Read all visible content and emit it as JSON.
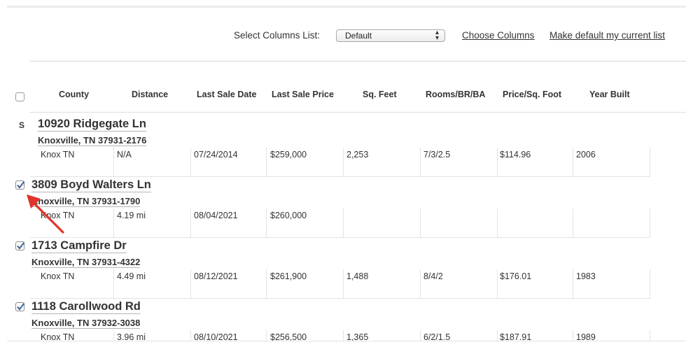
{
  "toolbar": {
    "columns_label": "Select Columns List:",
    "columns_value": "Default",
    "choose_columns": "Choose Columns",
    "make_default": "Make default my current list"
  },
  "headers": [
    "County",
    "Distance",
    "Last Sale Date",
    "Last Sale Price",
    "Sq. Feet",
    "Rooms/BR/BA",
    "Price/Sq. Foot",
    "Year Built"
  ],
  "listings": [
    {
      "tag": "S",
      "checked": false,
      "address": "10920 Ridgegate Ln",
      "city": "Knoxville, TN 37931-2176",
      "county": "Knox TN",
      "distance": "N/A",
      "sale_date": "07/24/2014",
      "sale_price": "$259,000",
      "sqft": "2,253",
      "rooms": "7/3/2.5",
      "price_sqft": "$114.96",
      "year": "2006"
    },
    {
      "tag": "",
      "checked": true,
      "address": "3809 Boyd Walters Ln",
      "city": "Knoxville, TN 37931-1790",
      "county": "Knox TN",
      "distance": "4.19 mi",
      "sale_date": "08/04/2021",
      "sale_price": "$260,000",
      "sqft": "",
      "rooms": "",
      "price_sqft": "",
      "year": ""
    },
    {
      "tag": "",
      "checked": true,
      "address": "1713 Campfire Dr",
      "city": "Knoxville, TN 37931-4322",
      "county": "Knox TN",
      "distance": "4.49 mi",
      "sale_date": "08/12/2021",
      "sale_price": "$261,900",
      "sqft": "1,488",
      "rooms": "8/4/2",
      "price_sqft": "$176.01",
      "year": "1983"
    },
    {
      "tag": "",
      "checked": true,
      "address": "1118 Carollwood Rd",
      "city": "Knoxville, TN 37932-3038",
      "county": "Knox TN",
      "distance": "3.96 mi",
      "sale_date": "08/10/2021",
      "sale_price": "$256,500",
      "sqft": "1,365",
      "rooms": "6/2/1.5",
      "price_sqft": "$187.91",
      "year": "1989"
    }
  ],
  "colors": {
    "annotation_arrow": "#e0332b",
    "check": "#4a6a9a"
  }
}
